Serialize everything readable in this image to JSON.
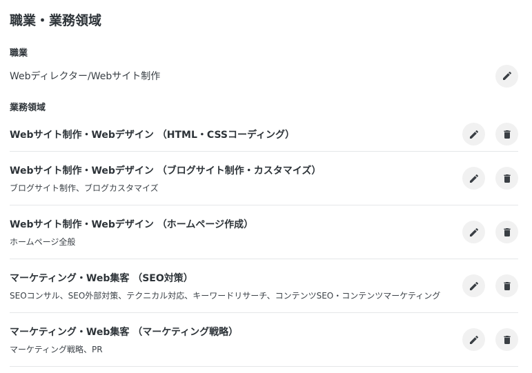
{
  "page": {
    "title": "職業・業務領域"
  },
  "occupation": {
    "heading": "職業",
    "value": "Webディレクター/Webサイト制作",
    "edit_icon": "pencil-icon"
  },
  "business_areas": {
    "heading": "業務領域",
    "items": [
      {
        "title": "Webサイト制作・Webデザイン （HTML・CSSコーディング）",
        "detail": ""
      },
      {
        "title": "Webサイト制作・Webデザイン （ブログサイト制作・カスタマイズ）",
        "detail": "ブログサイト制作、ブログカスタマイズ"
      },
      {
        "title": "Webサイト制作・Webデザイン （ホームページ作成）",
        "detail": "ホームページ全般"
      },
      {
        "title": "マーケティング・Web集客 （SEO対策）",
        "detail": "SEOコンサル、SEO外部対策、テクニカル対応、キーワードリサーチ、コンテンツSEO・コンテンツマーケティング"
      },
      {
        "title": "マーケティング・Web集客 （マーケティング戦略）",
        "detail": "マーケティング戦略、PR"
      }
    ],
    "edit_icon": "pencil-icon",
    "delete_icon": "trash-icon"
  },
  "colors": {
    "text": "#2d3338",
    "button_bg": "#f1f1f1",
    "divider": "#e4e6e8"
  }
}
